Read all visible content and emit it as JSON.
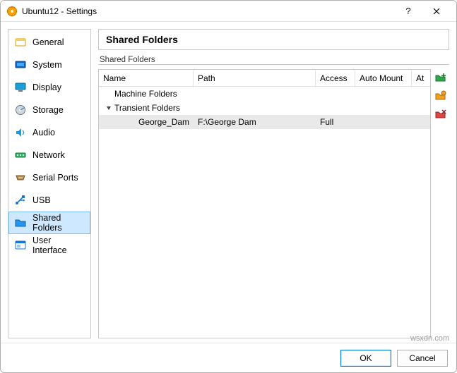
{
  "window": {
    "title": "Ubuntu12 - Settings"
  },
  "sidebar": {
    "items": [
      {
        "id": "general",
        "label": "General"
      },
      {
        "id": "system",
        "label": "System"
      },
      {
        "id": "display",
        "label": "Display"
      },
      {
        "id": "storage",
        "label": "Storage"
      },
      {
        "id": "audio",
        "label": "Audio"
      },
      {
        "id": "network",
        "label": "Network"
      },
      {
        "id": "serial",
        "label": "Serial Ports"
      },
      {
        "id": "usb",
        "label": "USB"
      },
      {
        "id": "shared",
        "label": "Shared Folders",
        "selected": true
      },
      {
        "id": "ui",
        "label": "User Interface"
      }
    ]
  },
  "page": {
    "title": "Shared Folders",
    "section_label": "Shared Folders",
    "columns": {
      "name": "Name",
      "path": "Path",
      "access": "Access",
      "automount": "Auto Mount",
      "at": "At"
    },
    "groups": {
      "machine": "Machine Folders",
      "transient": "Transient Folders"
    },
    "entries": [
      {
        "name": "George_Dam",
        "path": "F:\\George Dam",
        "access": "Full",
        "automount": "",
        "at": ""
      }
    ]
  },
  "footer": {
    "ok": "OK",
    "cancel": "Cancel"
  },
  "watermark": "wsxdn.com"
}
